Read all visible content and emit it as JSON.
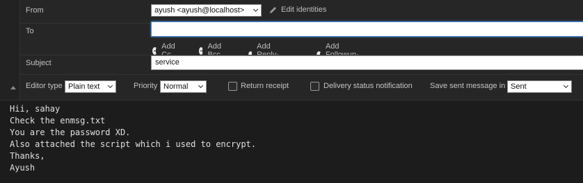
{
  "from": {
    "label": "From",
    "identity": "ayush <ayush@localhost>",
    "edit_identities": "Edit identities"
  },
  "to": {
    "label": "To",
    "value": ""
  },
  "add_links": [
    "Add Cc",
    "Add Bcc",
    "Add Reply-To",
    "Add Followup-To"
  ],
  "subject": {
    "label": "Subject",
    "value": "service"
  },
  "options": {
    "editor_type_label": "Editor type",
    "editor_type_value": "Plain text",
    "priority_label": "Priority",
    "priority_value": "Normal",
    "return_receipt_label": "Return receipt",
    "return_receipt_checked": false,
    "dsn_label": "Delivery status notification",
    "dsn_checked": false,
    "save_sent_label": "Save sent message in",
    "save_sent_value": "Sent"
  },
  "body_lines": [
    "Hii, sahay",
    "Check the enmsg.txt",
    "You are the password XD.",
    "Also attached the script which i used to encrypt.",
    "Thanks,",
    "Ayush"
  ],
  "colors": {
    "focus": "#4a8dd6",
    "background": "#1f1f1f"
  }
}
